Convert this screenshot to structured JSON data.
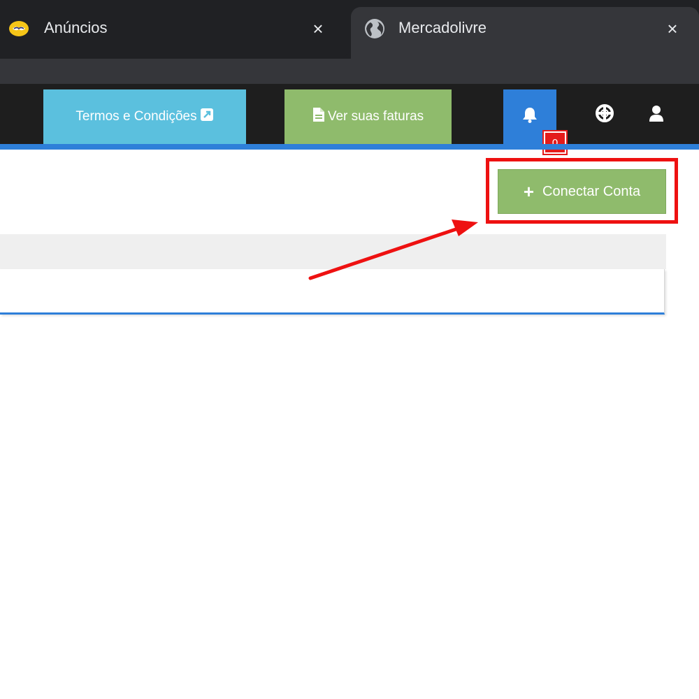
{
  "browser": {
    "tabs": [
      {
        "title": "Anúncios",
        "icon": "handshake-icon",
        "close": "×",
        "active": false
      },
      {
        "title": "Mercadolivre",
        "icon": "globe-icon",
        "close": "×",
        "active": true
      }
    ]
  },
  "navbar": {
    "terms_label": "Termos e Condições",
    "terms_icon": "external-link-icon",
    "invoices_label": "Ver suas faturas",
    "invoices_icon": "file-icon",
    "notifications_icon": "bell-icon",
    "notification_count": "0",
    "help_icon": "life-ring-icon",
    "user_icon": "user-icon"
  },
  "main": {
    "connect_button_icon": "+",
    "connect_button_label": "Conectar Conta"
  },
  "colors": {
    "accent_blue": "#2e7fd9",
    "info_blue": "#5bc0de",
    "success_green": "#8fbb6c",
    "annotation_red": "#ee1111"
  }
}
